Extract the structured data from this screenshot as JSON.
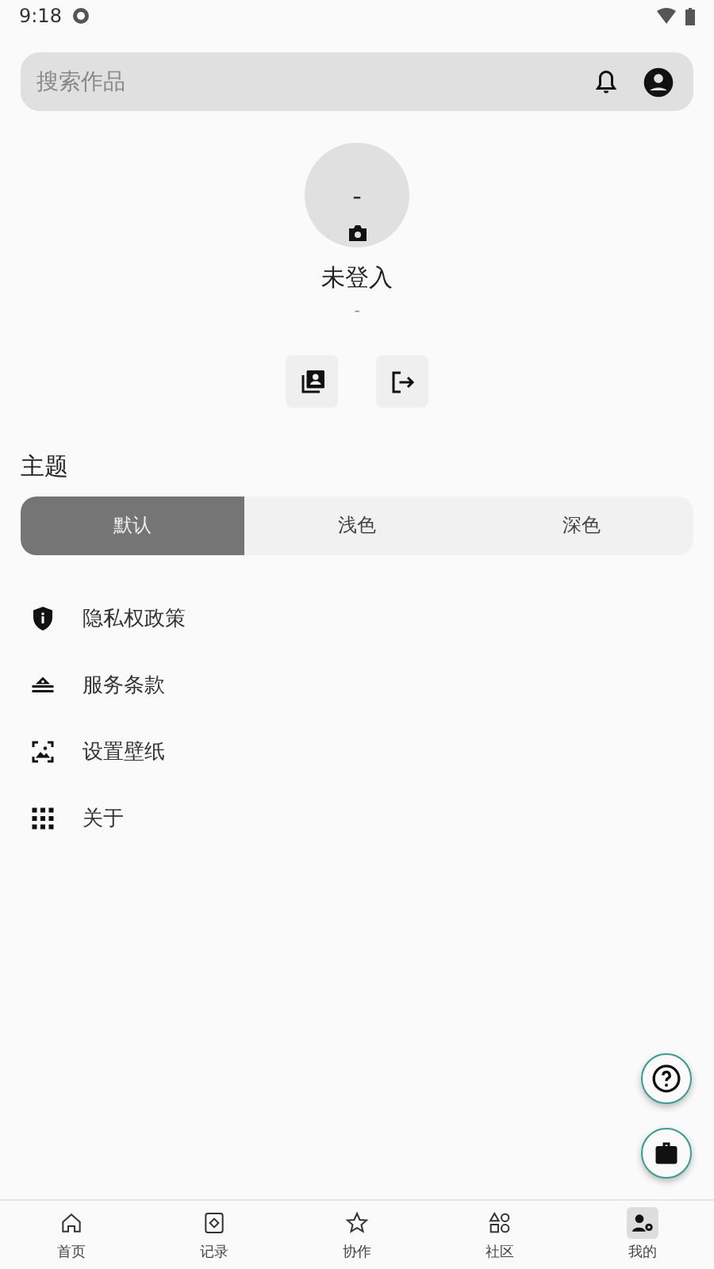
{
  "status_bar": {
    "time": "9:18"
  },
  "search": {
    "placeholder": "搜索作品"
  },
  "profile": {
    "avatar_text": "-",
    "name": "未登入",
    "subtitle": "-"
  },
  "theme": {
    "title": "主题",
    "options": [
      {
        "label": "默认",
        "selected": true
      },
      {
        "label": "浅色",
        "selected": false
      },
      {
        "label": "深色",
        "selected": false
      }
    ]
  },
  "menu": [
    {
      "label": "隐私权政策"
    },
    {
      "label": "服务条款"
    },
    {
      "label": "设置壁纸"
    },
    {
      "label": "关于"
    }
  ],
  "bottom_nav": [
    {
      "label": "首页",
      "selected": false
    },
    {
      "label": "记录",
      "selected": false
    },
    {
      "label": "协作",
      "selected": false
    },
    {
      "label": "社区",
      "selected": false
    },
    {
      "label": "我的",
      "selected": true
    }
  ]
}
